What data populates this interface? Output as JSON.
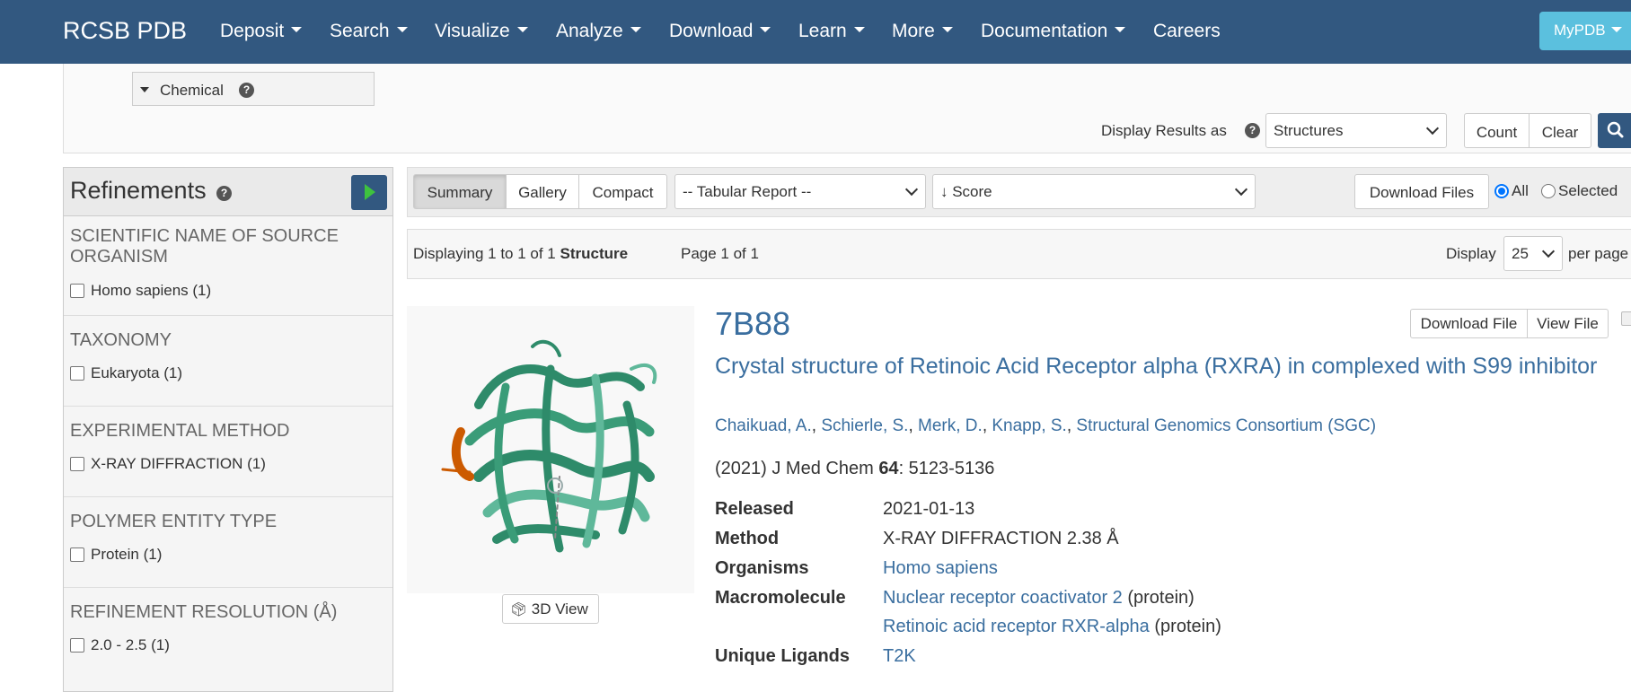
{
  "navbar": {
    "brand": "RCSB PDB",
    "items": [
      "Deposit",
      "Search",
      "Visualize",
      "Analyze",
      "Download",
      "Learn",
      "More",
      "Documentation",
      "Careers"
    ],
    "mypdb": "MyPDB",
    "bg_color": "#325880"
  },
  "search_panel": {
    "chemical_label": "Chemical",
    "display_results_label": "Display Results as",
    "display_results_value": "Structures",
    "count_label": "Count",
    "clear_label": "Clear"
  },
  "refinements": {
    "title": "Refinements",
    "facets": [
      {
        "title": "SCIENTIFIC NAME OF SOURCE ORGANISM",
        "option": "Homo sapiens (1)"
      },
      {
        "title": "TAXONOMY",
        "option": "Eukaryota (1)"
      },
      {
        "title": "EXPERIMENTAL METHOD",
        "option": "X-RAY DIFFRACTION (1)"
      },
      {
        "title": "POLYMER ENTITY TYPE",
        "option": "Protein (1)"
      },
      {
        "title": "REFINEMENT RESOLUTION (Å)",
        "option": "2.0 - 2.5 (1)"
      }
    ]
  },
  "toolbar": {
    "view_modes": [
      "Summary",
      "Gallery",
      "Compact"
    ],
    "active_view": "Summary",
    "tabular_report": "-- Tabular Report --",
    "sort": "↓ Score",
    "download_files": "Download Files",
    "radio_all": "All",
    "radio_selected": "Selected"
  },
  "info": {
    "displaying_prefix": "Displaying 1 to 1 of 1",
    "displaying_unit": "Structure",
    "page": "Page 1 of 1",
    "display_label": "Display",
    "per_page_value": "25",
    "per_page_label": "per page"
  },
  "result": {
    "id": "7B88",
    "download_file": "Download File",
    "view_file": "View File",
    "view3d": "3D View",
    "title": "Crystal structure of Retinoic Acid Receptor alpha (RXRA) in complexed with S99 inhibitor",
    "authors": [
      "Chaikuad, A.",
      "Schierle, S.",
      "Merk, D.",
      "Knapp, S.",
      "Structural Genomics Consortium (SGC)"
    ],
    "citation_prefix": "(2021) J Med Chem",
    "citation_volume": "64",
    "citation_pages": ": 5123-5136",
    "released_label": "Released",
    "released_value": "2021-01-13",
    "method_label": "Method",
    "method_value": "X-RAY DIFFRACTION 2.38 Å",
    "organisms_label": "Organisms",
    "organisms_value": "Homo sapiens",
    "macromolecule_label": "Macromolecule",
    "macromolecule_1": "Nuclear receptor coactivator 2",
    "macromolecule_2": "Retinoic acid receptor RXR-alpha",
    "protein_suffix": "(protein)",
    "ligands_label": "Unique Ligands",
    "ligands_value": "T2K",
    "protein_colors": {
      "helix": "#2e8b6a",
      "light": "#5fb89a",
      "ligand": "#cc5a00"
    }
  }
}
